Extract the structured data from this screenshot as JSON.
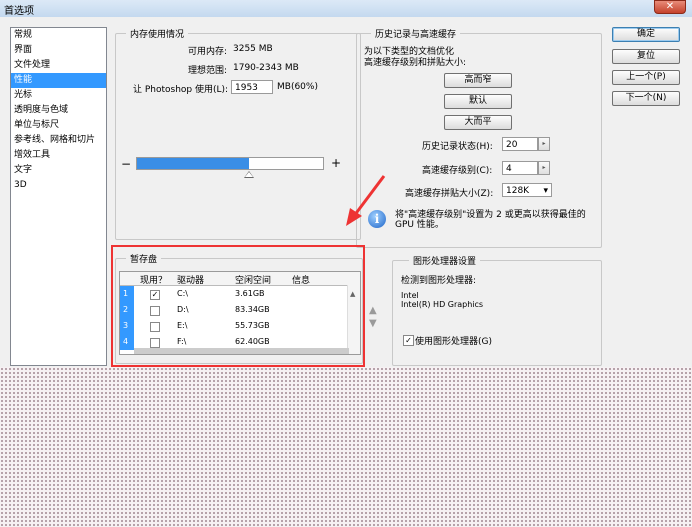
{
  "window": {
    "title": "首选项",
    "close_glyph": "✕"
  },
  "nav": {
    "items": [
      {
        "label": "常规"
      },
      {
        "label": "界面"
      },
      {
        "label": "文件处理"
      },
      {
        "label": "性能",
        "selected": true
      },
      {
        "label": "光标"
      },
      {
        "label": "透明度与色域"
      },
      {
        "label": "单位与标尺"
      },
      {
        "label": "参考线、网格和切片"
      },
      {
        "label": "增效工具"
      },
      {
        "label": "文字"
      },
      {
        "label": "3D"
      }
    ]
  },
  "memory": {
    "group_title": "内存使用情况",
    "available_label": "可用内存:",
    "available_value": "3255 MB",
    "ideal_label": "理想范围:",
    "ideal_value": "1790-2343 MB",
    "photoshop_label": "让 Photoshop 使用(L):",
    "photoshop_value": "1953",
    "photoshop_unit": "MB(60%)",
    "minus": "−",
    "plus": "+",
    "slider_level": 0.6
  },
  "history": {
    "group_title": "历史记录与高速缓存",
    "desc_line1": "为以下类型的文档优化",
    "desc_line2": "高速缓存级别和拼贴大小:",
    "btn_tall": "高而窄",
    "btn_default": "默认",
    "btn_big": "大而平",
    "states_label": "历史记录状态(H):",
    "states_value": "20",
    "cache_levels_label": "高速缓存级别(C):",
    "cache_levels_value": "4",
    "tile_label": "高速缓存拼贴大小(Z):",
    "tile_value": "128K",
    "info_text_line1": "将\"高速缓存级别\"设置为 2 或更高以获得最佳的",
    "info_text_line2": "GPU 性能。",
    "spin_glyph": "▸",
    "dropdown_glyph": "▾"
  },
  "scratch": {
    "group_title": "暂存盘",
    "headers": [
      "现用？",
      "驱动器",
      "空闲空间",
      "信息"
    ],
    "rows": [
      {
        "num": "1",
        "checked": true,
        "mark": "✓",
        "drive": "C:\\",
        "free": "3.61GB"
      },
      {
        "num": "2",
        "checked": false,
        "mark": "",
        "drive": "D:\\",
        "free": "83.34GB"
      },
      {
        "num": "3",
        "checked": false,
        "mark": "",
        "drive": "E:\\",
        "free": "55.73GB"
      },
      {
        "num": "4",
        "checked": false,
        "mark": "",
        "drive": "F:\\",
        "free": "62.40GB"
      }
    ],
    "up_glyph": "▲",
    "down_glyph": "▼",
    "scroll_up_glyph": "▲"
  },
  "gpu": {
    "group_title": "图形处理器设置",
    "detected_label": "检测到图形处理器:",
    "vendor": "Intel",
    "model": "Intel(R) HD Graphics",
    "use_gpu_label": "使用图形处理器(G)",
    "use_gpu_checked": true,
    "check_mark": "✓"
  },
  "buttons": {
    "ok": "确定",
    "reset": "复位",
    "prev": "上一个(P)",
    "next": "下一个(N)"
  },
  "colors": {
    "accent": "#3399ff",
    "annotation": "#e33333",
    "slider_fill": "#3a8ee6"
  }
}
